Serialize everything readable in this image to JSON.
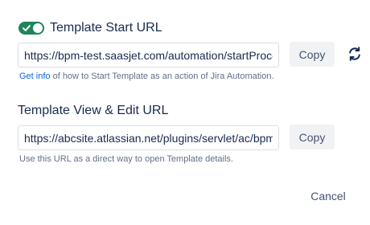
{
  "start_section": {
    "toggle_on": true,
    "title": "Template Start URL",
    "url_value": "https://bpm-test.saasjet.com/automation/startProcess",
    "copy_label": "Copy",
    "refresh_icon": "refresh-icon",
    "hint_link": "Get info",
    "hint_text": " of how to Start Template as an action of Jira Automation."
  },
  "view_section": {
    "title": "Template View & Edit URL",
    "url_value": "https://abcsite.atlassian.net/plugins/servlet/ac/bpm",
    "copy_label": "Copy",
    "hint_text": "Use this URL as a direct way to open Template details."
  },
  "footer": {
    "cancel_label": "Cancel"
  },
  "colors": {
    "toggle_on": "#1f845a",
    "link": "#0c66e4",
    "button_bg": "#f1f2f4",
    "input_border": "#dcdfe4"
  }
}
